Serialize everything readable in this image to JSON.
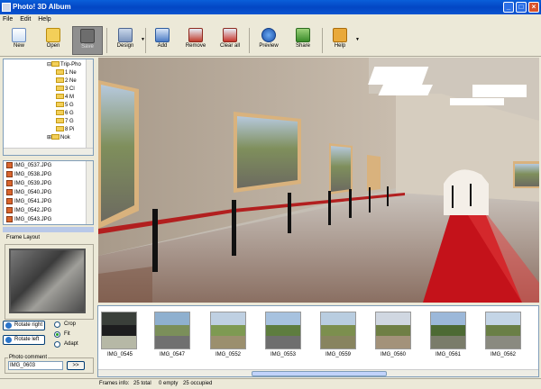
{
  "window": {
    "title": "Photo! 3D Album"
  },
  "menu": {
    "items": [
      "File",
      "Edit",
      "Help"
    ]
  },
  "toolbar": {
    "new": "New",
    "open": "Open",
    "save": "Save",
    "design": "Design",
    "add": "Add",
    "remove": "Remove",
    "clear": "Clear all",
    "preview": "Preview",
    "share": "Share",
    "help": "Help"
  },
  "tree": {
    "root": "Trip-Pho",
    "items": [
      "1 Ne",
      "2 Ne",
      "3 Cl",
      "4 M",
      "5 G",
      "6 G",
      "7 G",
      "8 Pi",
      "Nok"
    ]
  },
  "files": {
    "items": [
      "IMG_0537.JPG",
      "IMG_0538.JPG",
      "IMG_0539.JPG",
      "IMG_0540.JPG",
      "IMG_0541.JPG",
      "IMG_0542.JPG",
      "IMG_0543.JPG"
    ]
  },
  "frame": {
    "label": "Frame Layout"
  },
  "controls": {
    "rotate_right": "Rotate right",
    "rotate_left": "Rotate left",
    "crop": "Crop",
    "fit": "Fit",
    "adapt": "Adapt",
    "fit_selected": true
  },
  "comment": {
    "label": "Photo comment",
    "value": "IMG_0603",
    "go": ">>"
  },
  "thumbs": [
    {
      "label": "IMG_0545",
      "colors": [
        "#3a3f3a",
        "#1d1d1f",
        "#b6b8a6"
      ]
    },
    {
      "label": "IMG_0547",
      "colors": [
        "#8fb0cf",
        "#7b8f5a",
        "#707070"
      ]
    },
    {
      "label": "IMG_0552",
      "colors": [
        "#bfd0e2",
        "#7e9a52",
        "#9b8f6e"
      ]
    },
    {
      "label": "IMG_0553",
      "colors": [
        "#a7c2df",
        "#5e7d3f",
        "#6e6e6e"
      ]
    },
    {
      "label": "IMG_0559",
      "colors": [
        "#b9cde0",
        "#7c8f4e",
        "#88845f"
      ]
    },
    {
      "label": "IMG_0560",
      "colors": [
        "#d0d7e1",
        "#6f7f45",
        "#a3927a"
      ]
    },
    {
      "label": "IMG_0561",
      "colors": [
        "#9cb8d9",
        "#4d6a34",
        "#7a7c6a"
      ]
    },
    {
      "label": "IMG_0562",
      "colors": [
        "#c4d5e6",
        "#6a7f46",
        "#8a8a80"
      ]
    }
  ],
  "status": {
    "label": "Frames info:",
    "total": "25 total",
    "empty": "0 empty",
    "occupied": "25 occupied"
  }
}
